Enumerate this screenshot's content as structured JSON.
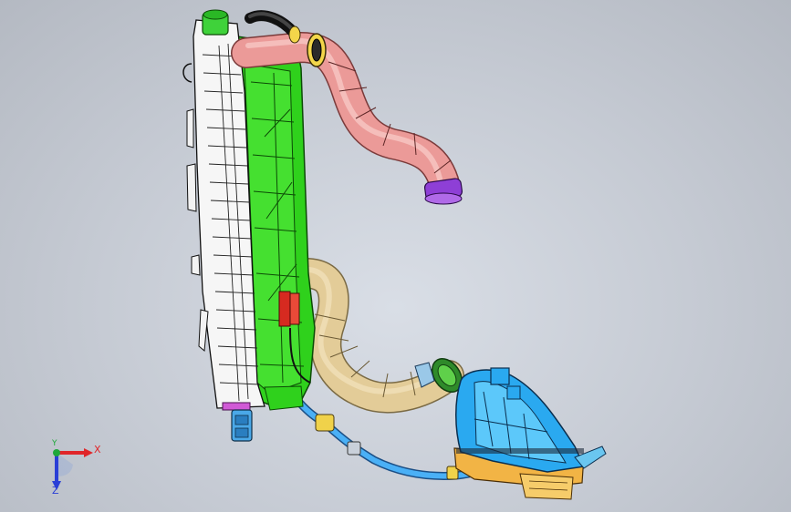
{
  "viewport": {
    "background_top": "#d9dee6",
    "background_bottom": "#b4b9c2"
  },
  "triad": {
    "x_label": "X",
    "y_label": "Y",
    "z_label": "Z",
    "x_color": "#e0262a",
    "y_color": "#1fa83a",
    "z_color": "#2a3fd6"
  },
  "parts": [
    {
      "name": "radiator-core",
      "color": "#ffffff"
    },
    {
      "name": "radiator-shroud",
      "color": "#31d51f"
    },
    {
      "name": "upper-hose",
      "color": "#e8918f"
    },
    {
      "name": "lower-hose",
      "color": "#d9c08a"
    },
    {
      "name": "expansion-tank",
      "color": "#2aa9f0"
    },
    {
      "name": "tank-bracket",
      "color": "#f2b445"
    },
    {
      "name": "overflow-hose",
      "color": "#3aa3f0"
    },
    {
      "name": "sensor-connector",
      "color": "#d62a20"
    },
    {
      "name": "hose-clamp",
      "color": "#8e3fd6"
    }
  ]
}
